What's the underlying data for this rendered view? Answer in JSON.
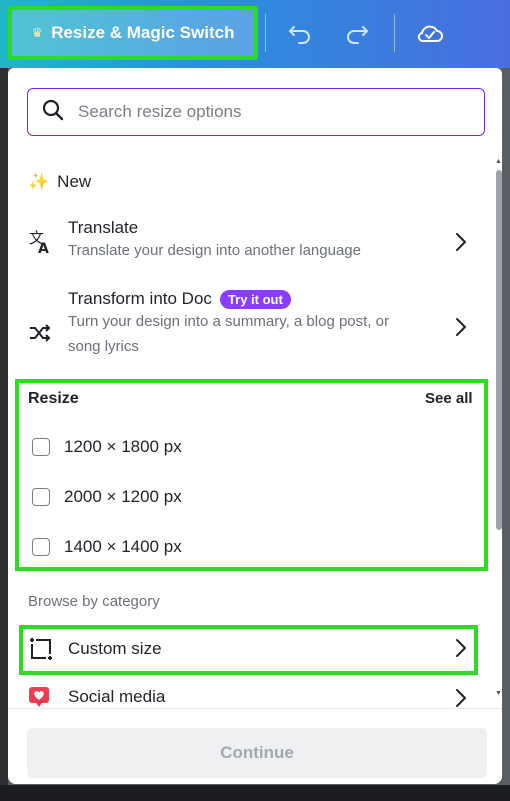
{
  "toolbar": {
    "resize_label": "Resize & Magic Switch",
    "crown_icon": "crown-icon",
    "undo_icon": "undo-icon",
    "redo_icon": "redo-icon",
    "saved_icon": "cloud-check-icon"
  },
  "search": {
    "placeholder": "Search resize options"
  },
  "new_section": {
    "label": "New",
    "icon": "sparkles-icon"
  },
  "features": [
    {
      "title": "Translate",
      "description": "Translate your design into another language",
      "icon": "translate-icon"
    },
    {
      "title": "Transform into Doc",
      "badge": "Try it out",
      "description_line1": "Turn your design into a summary, a blog post, or",
      "description_line2": "song lyrics",
      "icon": "shuffle-icon"
    }
  ],
  "resize": {
    "heading": "Resize",
    "see_all": "See all",
    "sizes": [
      "1200 × 1800 px",
      "2000 × 1200 px",
      "1400 × 1400 px"
    ]
  },
  "browse": {
    "heading": "Browse by category",
    "items": [
      {
        "label": "Custom size",
        "icon": "custom-size-icon"
      },
      {
        "label": "Social media",
        "icon": "heart-icon"
      }
    ]
  },
  "footer": {
    "continue_label": "Continue"
  },
  "colors": {
    "accent": "#7d2ae8",
    "badge": "#8b3dff",
    "highlight": "#2bdc22",
    "heart": "#ee3d4f"
  }
}
